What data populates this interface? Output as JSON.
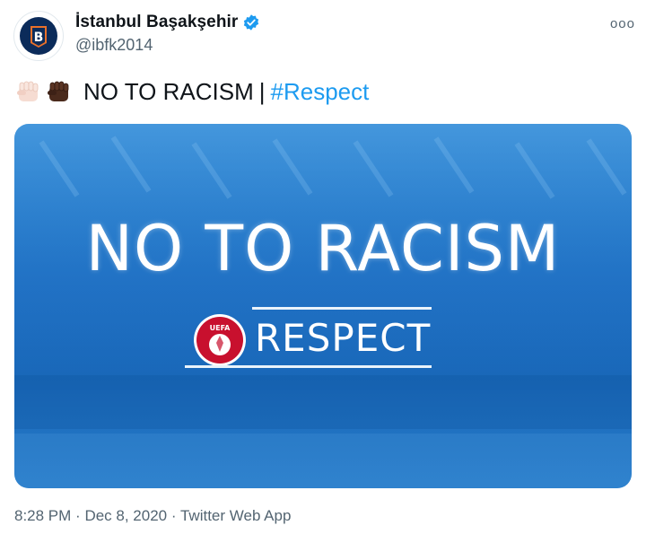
{
  "account": {
    "display_name": "İstanbul Başakşehir",
    "handle": "@ibfk2014",
    "avatar_letter": "B"
  },
  "tweet": {
    "emojis": [
      "raised-fist-light",
      "raised-fist-dark"
    ],
    "text": "NO TO RACISM",
    "separator": "|",
    "hashtag": "#Respect"
  },
  "media": {
    "headline": "NO TO RACISM",
    "logo_text": "UEFA",
    "subline": "RESPECT"
  },
  "meta": {
    "time": "8:28 PM",
    "date": "Dec 8, 2020",
    "source": "Twitter Web App",
    "dot": "·"
  },
  "more_menu": "ooo",
  "colors": {
    "link": "#1d9bf0",
    "secondary_text": "#536471",
    "media_blue": "#1e6ec2",
    "verified": "#1d9bf0"
  }
}
